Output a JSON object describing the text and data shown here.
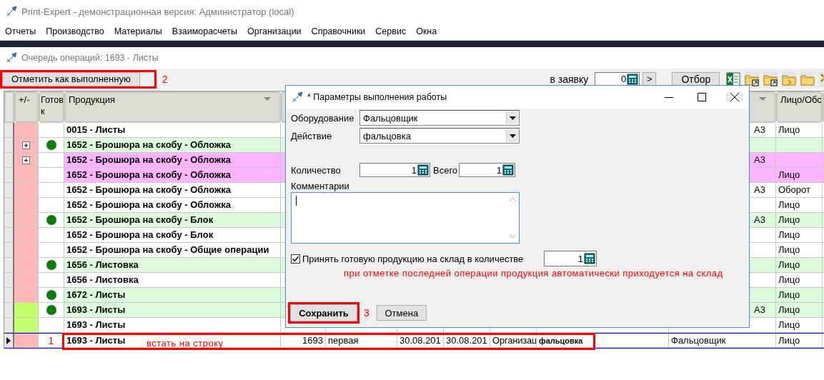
{
  "app": {
    "title": "Print-Expert - демонстрационная версия: Администратор (local)"
  },
  "menu": [
    {
      "label": "Отчеты"
    },
    {
      "label": "Производство"
    },
    {
      "label": "Материалы"
    },
    {
      "label": "Взаиморасчеты"
    },
    {
      "label": "Организации"
    },
    {
      "label": "Справочники"
    },
    {
      "label": "Сервис"
    },
    {
      "label": "Окна"
    }
  ],
  "document": {
    "title": "Очередь операций: 1693 - Листы"
  },
  "toolbar": {
    "mark_done_button": "Отметить как выполненную",
    "step_note": "2",
    "order_label": "в заявку",
    "order_value": "0",
    "go_button": ">",
    "filter_button": "Отбор"
  },
  "grid": {
    "expand_column": "+/-",
    "ready_column": "Готов к",
    "product_column": "Продукция",
    "face_column": "Лицо/Обс",
    "rows": [
      {
        "status": {
          "color": "#ffb8b8"
        },
        "expandable": false,
        "ready": false,
        "product": "0015 - Листы",
        "color": "#ffffff",
        "selected": false,
        "column_10": "А3",
        "face": "Лицо"
      },
      {
        "status": {
          "color": "#ffb8b8"
        },
        "expandable": true,
        "ready": true,
        "product": "1652 - Брошюра на скобу - Обложка",
        "color": "#dcfcdc",
        "selected": false
      },
      {
        "status": {
          "color": "#ffb8b8"
        },
        "expandable": true,
        "ready": false,
        "product": "1652 - Брошюра на скобу - Обложка",
        "color": "#ffb4ff",
        "selected": false,
        "column_10": "А3"
      },
      {
        "status": {
          "color": "#ffb8b8"
        },
        "expandable": false,
        "ready": false,
        "product": "1652 - Брошюра на скобу - Обложка",
        "color": "#ffb4ff",
        "selected": false,
        "face": "Лицо"
      },
      {
        "status": {
          "color": "#ffb8b8"
        },
        "expandable": false,
        "ready": false,
        "product": "1652 - Брошюра на скобу - Обложка",
        "color": "#ffffff",
        "selected": false,
        "column_10": "А3",
        "face": "Оборот"
      },
      {
        "status": {
          "color": "#ffb8b8"
        },
        "expandable": false,
        "ready": false,
        "product": "1652 - Брошюра на скобу - Обложка",
        "color": "#ffffff",
        "selected": false,
        "face": "Лицо"
      },
      {
        "status": {
          "color": "#ffb8b8"
        },
        "expandable": false,
        "ready": true,
        "product": "1652 - Брошюра на скобу - Блок",
        "color": "#dcfcdc",
        "selected": false,
        "column_10": "А3",
        "face": "Лицо"
      },
      {
        "status": {
          "color": "#ffb8b8"
        },
        "expandable": false,
        "ready": false,
        "product": "1652 - Брошюра на скобу - Блок",
        "color": "#ffffff",
        "selected": false,
        "face": "Лицо"
      },
      {
        "status": {
          "color": "#ffb8b8"
        },
        "expandable": false,
        "ready": false,
        "product": "1652 - Брошюра на скобу - Общие операции",
        "color": "#ffffff",
        "selected": false,
        "face": "Лицо"
      },
      {
        "status": {
          "color": "#ffb8b8"
        },
        "expandable": false,
        "ready": true,
        "product": "1656 - Листовка",
        "color": "#dcfcdc",
        "selected": false,
        "face": "Лицо"
      },
      {
        "status": {
          "color": "#ffb8b8"
        },
        "expandable": false,
        "ready": false,
        "product": "1656 - Листовка",
        "color": "#ffffff",
        "selected": false,
        "face": "Лицо"
      },
      {
        "status": {
          "color": "#ffb8b8"
        },
        "expandable": false,
        "ready": true,
        "product": "1672 - Листы",
        "color": "#dcfcdc",
        "selected": false,
        "face": "Лицо"
      },
      {
        "status": {
          "color": "#c4ff6c"
        },
        "expandable": false,
        "ready": true,
        "product": "1693 - Листы",
        "color": "#dcfcdc",
        "selected": false,
        "column_10": "А3",
        "face": "Лицо"
      },
      {
        "status": {
          "color": "#c4ff6c"
        },
        "expandable": false,
        "ready": false,
        "product": "1693 - Листы",
        "color": "#ffffff",
        "selected": false,
        "face": "Лицо"
      },
      {
        "status": {
          "color": "#ffb8b8"
        },
        "expandable": false,
        "ready": false,
        "step_note": "1",
        "product": "1693 - Листы",
        "color": "#ffffff",
        "selected": true,
        "cells": [
          "1693",
          "первая",
          "30.08.201",
          "30.08.201",
          "Организац",
          "фальцовка",
          "Фальцовщик"
        ],
        "face": "Лицо"
      }
    ]
  },
  "row_hint": "встать на строку",
  "dialog": {
    "title": "* Параметры выполнения работы",
    "equipment_label": "Оборудование",
    "equipment_value": "Фальцовщик",
    "action_label": "Действие",
    "action_value": "фальцовка",
    "quantity_label": "Количество",
    "quantity_value": "1",
    "total_label": "Всего",
    "total_value": "1",
    "comments_label": "Комментарии",
    "accept_checked": true,
    "accept_label": "Принять готовую продукцию на склад в количестве",
    "accept_quantity": "1",
    "auto_note": "при отметке последней операции продукция автоматически приходуется на склад",
    "save_button": "Сохранить",
    "step_note": "3",
    "cancel_button": "Отмена"
  }
}
